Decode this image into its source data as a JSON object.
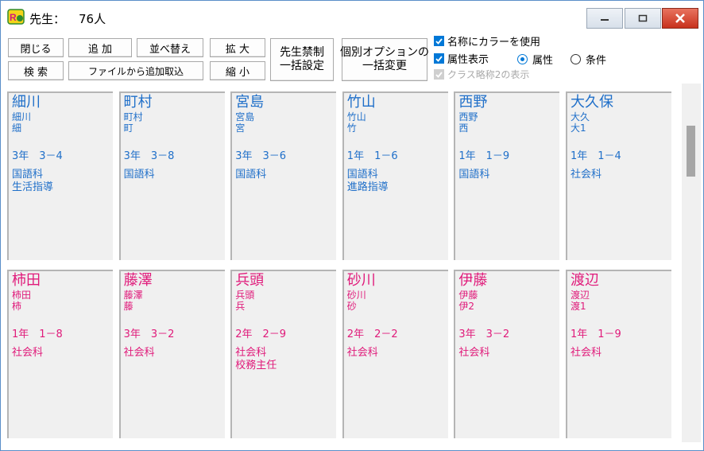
{
  "window": {
    "title_label": "先生：",
    "title_count": "76人"
  },
  "toolbar": {
    "close": "閉じる",
    "add": "追 加",
    "sort": "並べ替え",
    "zoom_in": "拡 大",
    "search": "検 索",
    "import": "ファイルから追加取込",
    "zoom_out": "縮 小",
    "ban_line1": "先生禁制",
    "ban_line2": "一括設定",
    "option_line1": "個別オプションの",
    "option_line2": "一括変更"
  },
  "options": {
    "color_name": "名称にカラーを使用",
    "show_attr": "属性表示",
    "radio_attr": "属性",
    "radio_cond": "条件",
    "class_abbr": "クラス略称2の表示"
  },
  "colors": {
    "blue": "#1f6fc9",
    "pink": "#e01a7a"
  },
  "teachers": [
    {
      "name": "細川",
      "short1": "細川",
      "short2": "細",
      "grade": "3年　3－4",
      "attrs": [
        "国語科",
        "生活指導"
      ],
      "color": "blue"
    },
    {
      "name": "町村",
      "short1": "町村",
      "short2": "町",
      "grade": "3年　3－8",
      "attrs": [
        "国語科"
      ],
      "color": "blue"
    },
    {
      "name": "宮島",
      "short1": "宮島",
      "short2": "宮",
      "grade": "3年　3－6",
      "attrs": [
        "国語科"
      ],
      "color": "blue"
    },
    {
      "name": "竹山",
      "short1": "竹山",
      "short2": "竹",
      "grade": "1年　1－6",
      "attrs": [
        "国語科",
        "進路指導"
      ],
      "color": "blue"
    },
    {
      "name": "西野",
      "short1": "西野",
      "short2": "西",
      "grade": "1年　1－9",
      "attrs": [
        "国語科"
      ],
      "color": "blue"
    },
    {
      "name": "大久保",
      "short1": "大久",
      "short2": "大1",
      "grade": "1年　1－4",
      "attrs": [
        "社会科"
      ],
      "color": "blue"
    },
    {
      "name": "柿田",
      "short1": "柿田",
      "short2": "柿",
      "grade": "1年　1－8",
      "attrs": [
        "社会科"
      ],
      "color": "pink"
    },
    {
      "name": "藤澤",
      "short1": "藤澤",
      "short2": "藤",
      "grade": "3年　3－2",
      "attrs": [
        "社会科"
      ],
      "color": "pink"
    },
    {
      "name": "兵頭",
      "short1": "兵頭",
      "short2": "兵",
      "grade": "2年　2－9",
      "attrs": [
        "社会科",
        "校務主任"
      ],
      "color": "pink"
    },
    {
      "name": "砂川",
      "short1": "砂川",
      "short2": "砂",
      "grade": "2年　2－2",
      "attrs": [
        "社会科"
      ],
      "color": "pink"
    },
    {
      "name": "伊藤",
      "short1": "伊藤",
      "short2": "伊2",
      "grade": "3年　3－2",
      "attrs": [
        "社会科"
      ],
      "color": "pink"
    },
    {
      "name": "渡辺",
      "short1": "渡辺",
      "short2": "渡1",
      "grade": "1年　1－9",
      "attrs": [
        "社会科"
      ],
      "color": "pink"
    }
  ]
}
